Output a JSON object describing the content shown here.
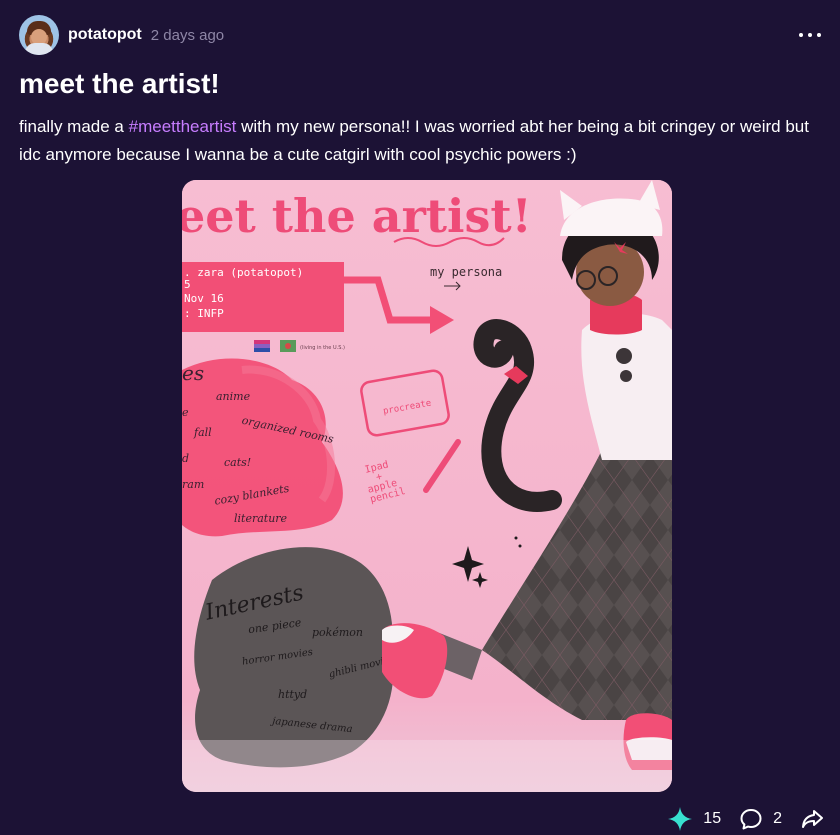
{
  "post": {
    "author": "potatopot",
    "time": "2 days ago",
    "title": "meet the artist!",
    "text_before": "finally made a ",
    "hashtag": "#meettheartist",
    "text_after": " with my new persona!! I was worried abt her being a bit cringey or weird but idc anymore because I wanna be a cute catgirl with cool psychic powers :)"
  },
  "image": {
    "heading": "eet the artist!",
    "info_lines": [
      ". zara (potatopot)",
      "5",
      "Nov 16",
      ": INFP"
    ],
    "flags_note": "(living in the U.S.)",
    "persona_label": "my persona",
    "tool_label": "procreate",
    "tool_note": [
      "Ipad",
      "+",
      "apple",
      "pencil"
    ],
    "likes_title": "es",
    "likes": [
      "anime",
      "fall",
      "organized rooms",
      "cats!",
      "cozy blankets",
      "literature",
      "e",
      "d",
      "ram"
    ],
    "interests_title": "Interests",
    "interests": [
      "one piece",
      "pokémon",
      "horror movies",
      "ghibli movies",
      "httyd",
      "japanese drama"
    ]
  },
  "actions": {
    "likes": "15",
    "comments": "2"
  },
  "colors": {
    "background": "#1c1235",
    "hashtag": "#c77dff",
    "like_icon": "#38e0d0"
  },
  "icons": [
    "more-icon",
    "sparkle-like-icon",
    "comment-icon",
    "share-icon"
  ]
}
